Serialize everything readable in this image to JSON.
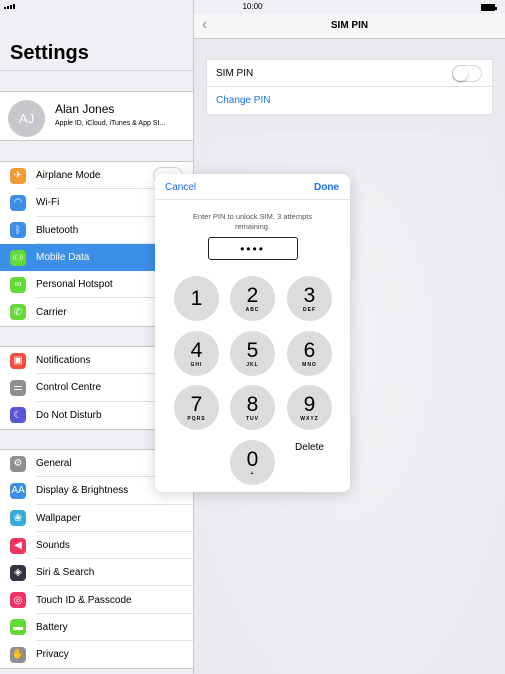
{
  "status_bar": {
    "time": "10:00"
  },
  "sidebar": {
    "title": "Settings",
    "profile": {
      "initials": "AJ",
      "name": "Alan Jones",
      "subtitle": "Apple ID, iCloud, iTunes & App St..."
    },
    "group1": [
      {
        "label": "Airplane Mode",
        "icon": "airplane-icon",
        "color": "#f19a37",
        "glyph": "✈"
      },
      {
        "label": "Wi-Fi",
        "icon": "wifi-icon",
        "color": "#3b8fe6",
        "glyph": "◠"
      },
      {
        "label": "Bluetooth",
        "icon": "bluetooth-icon",
        "color": "#3b8fe6",
        "glyph": "ᛒ"
      },
      {
        "label": "Mobile Data",
        "icon": "antenna-icon",
        "color": "#63da38",
        "glyph": "((·))"
      },
      {
        "label": "Personal Hotspot",
        "icon": "hotspot-icon",
        "color": "#63da38",
        "glyph": "∞"
      },
      {
        "label": "Carrier",
        "icon": "phone-icon",
        "color": "#63da38",
        "glyph": "✆"
      }
    ],
    "group2": [
      {
        "label": "Notifications",
        "icon": "notifications-icon",
        "color": "#f44c3f",
        "glyph": "▣"
      },
      {
        "label": "Control Centre",
        "icon": "control-centre-icon",
        "color": "#8e8e93",
        "glyph": "⚌"
      },
      {
        "label": "Do Not Disturb",
        "icon": "moon-icon",
        "color": "#5856d6",
        "glyph": "☾"
      }
    ],
    "group3": [
      {
        "label": "General",
        "icon": "gear-icon",
        "color": "#8e8e93",
        "glyph": "⚙"
      },
      {
        "label": "Display & Brightness",
        "icon": "display-icon",
        "color": "#3b8fe6",
        "glyph": "AA"
      },
      {
        "label": "Wallpaper",
        "icon": "wallpaper-icon",
        "color": "#35aadc",
        "glyph": "❀"
      },
      {
        "label": "Sounds",
        "icon": "speaker-icon",
        "color": "#f2335f",
        "glyph": "◀"
      },
      {
        "label": "Siri & Search",
        "icon": "siri-icon",
        "color": "#333344",
        "glyph": "◈"
      },
      {
        "label": "Touch ID & Passcode",
        "icon": "fingerprint-icon",
        "color": "#f2335f",
        "glyph": "◎"
      },
      {
        "label": "Battery",
        "icon": "battery-icon",
        "color": "#63da38",
        "glyph": "▬"
      },
      {
        "label": "Privacy",
        "icon": "hand-icon",
        "color": "#8e8e93",
        "glyph": "✋"
      }
    ]
  },
  "navbar": {
    "title": "SIM PIN"
  },
  "sim_settings": {
    "sim_pin_label": "SIM PIN",
    "change_pin_label": "Change PIN"
  },
  "dialog": {
    "cancel": "Cancel",
    "done": "Done",
    "prompt": "Enter PIN to unlock SIM. 3 attempts remaining.",
    "pin_value": "••••",
    "keys": [
      {
        "num": "1",
        "sub": ""
      },
      {
        "num": "2",
        "sub": "ABC"
      },
      {
        "num": "3",
        "sub": "DEF"
      },
      {
        "num": "4",
        "sub": "GHI"
      },
      {
        "num": "5",
        "sub": "JKL"
      },
      {
        "num": "6",
        "sub": "MNO"
      },
      {
        "num": "7",
        "sub": "PQRS"
      },
      {
        "num": "8",
        "sub": "TUV"
      },
      {
        "num": "9",
        "sub": "WXYZ"
      },
      {
        "num": "0",
        "sub": "+"
      }
    ],
    "delete": "Delete"
  }
}
